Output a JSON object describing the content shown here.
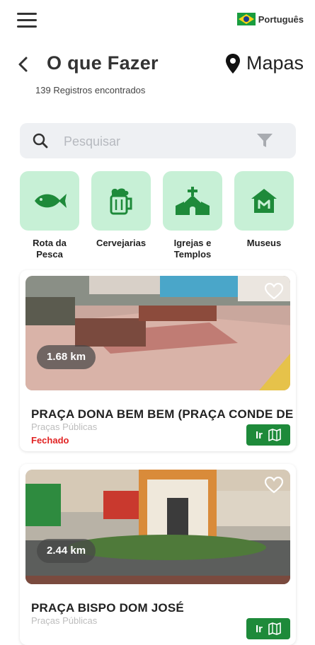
{
  "header": {
    "language": "Português",
    "title": "O que Fazer",
    "maps_label": "Mapas",
    "records_count": "139",
    "records_label": "Registros encontrados"
  },
  "search": {
    "placeholder": "Pesquisar",
    "value": ""
  },
  "categories": [
    {
      "label": "Rota da Pesca",
      "icon": "fish-icon"
    },
    {
      "label": "Cervejarias",
      "icon": "beer-mug-icon"
    },
    {
      "label": "Igrejas e Templos",
      "icon": "church-icon"
    },
    {
      "label": "Museus",
      "icon": "museum-icon"
    }
  ],
  "places": [
    {
      "distance": "1.68 km",
      "name": "PRAÇA DONA BEM BEM (PRAÇA CONDE DE",
      "category": "Praças Públicas",
      "status": "Fechado",
      "go_label": "Ir"
    },
    {
      "distance": "2.44 km",
      "name": "PRAÇA BISPO DOM JOSÉ",
      "category": "Praças Públicas",
      "status": "",
      "go_label": "Ir"
    }
  ],
  "colors": {
    "accent_green": "#1e8a3a",
    "category_bg": "#c7f0d6",
    "status_closed": "#e12323",
    "search_bg": "#eef0f3"
  }
}
